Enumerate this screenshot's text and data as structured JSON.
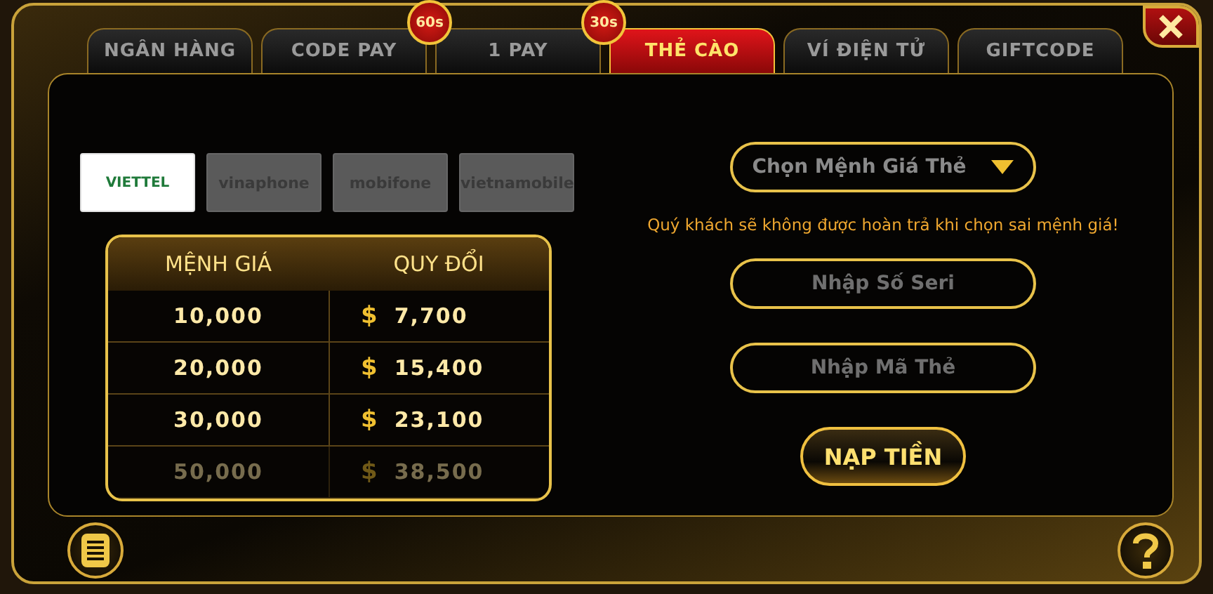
{
  "tabs": [
    {
      "label": "NGÂN HÀNG",
      "selected": false
    },
    {
      "label": "CODE PAY",
      "selected": false,
      "badge": "60s"
    },
    {
      "label": "1 PAY",
      "selected": false,
      "badge": "30s"
    },
    {
      "label": "THẺ CÀO",
      "selected": true
    },
    {
      "label": "VÍ ĐIỆN TỬ",
      "selected": false
    },
    {
      "label": "GIFTCODE",
      "selected": false
    }
  ],
  "carriers": [
    {
      "name": "VIETTEL",
      "selected": true
    },
    {
      "name": "vinaphone",
      "selected": false
    },
    {
      "name": "mobifone",
      "selected": false
    },
    {
      "name": "vietnamobile",
      "selected": false
    }
  ],
  "table": {
    "columns": [
      "MỆNH GIÁ",
      "QUY ĐỔI"
    ],
    "rows": [
      {
        "value": "10,000",
        "currency": "$",
        "exchange": "7,700",
        "dimmed": false
      },
      {
        "value": "20,000",
        "currency": "$",
        "exchange": "15,400",
        "dimmed": false
      },
      {
        "value": "30,000",
        "currency": "$",
        "exchange": "23,100",
        "dimmed": false
      },
      {
        "value": "50,000",
        "currency": "$",
        "exchange": "38,500",
        "dimmed": true
      }
    ]
  },
  "denomination_select": {
    "placeholder": "Chọn Mệnh Giá Thẻ"
  },
  "warning": "Quý khách sẽ không được hoàn trả khi chọn sai mệnh giá!",
  "serial_field": {
    "placeholder": "Nhập Số Seri"
  },
  "code_field": {
    "placeholder": "Nhập Mã Thẻ"
  },
  "submit_button": "NẠP TIỀN"
}
